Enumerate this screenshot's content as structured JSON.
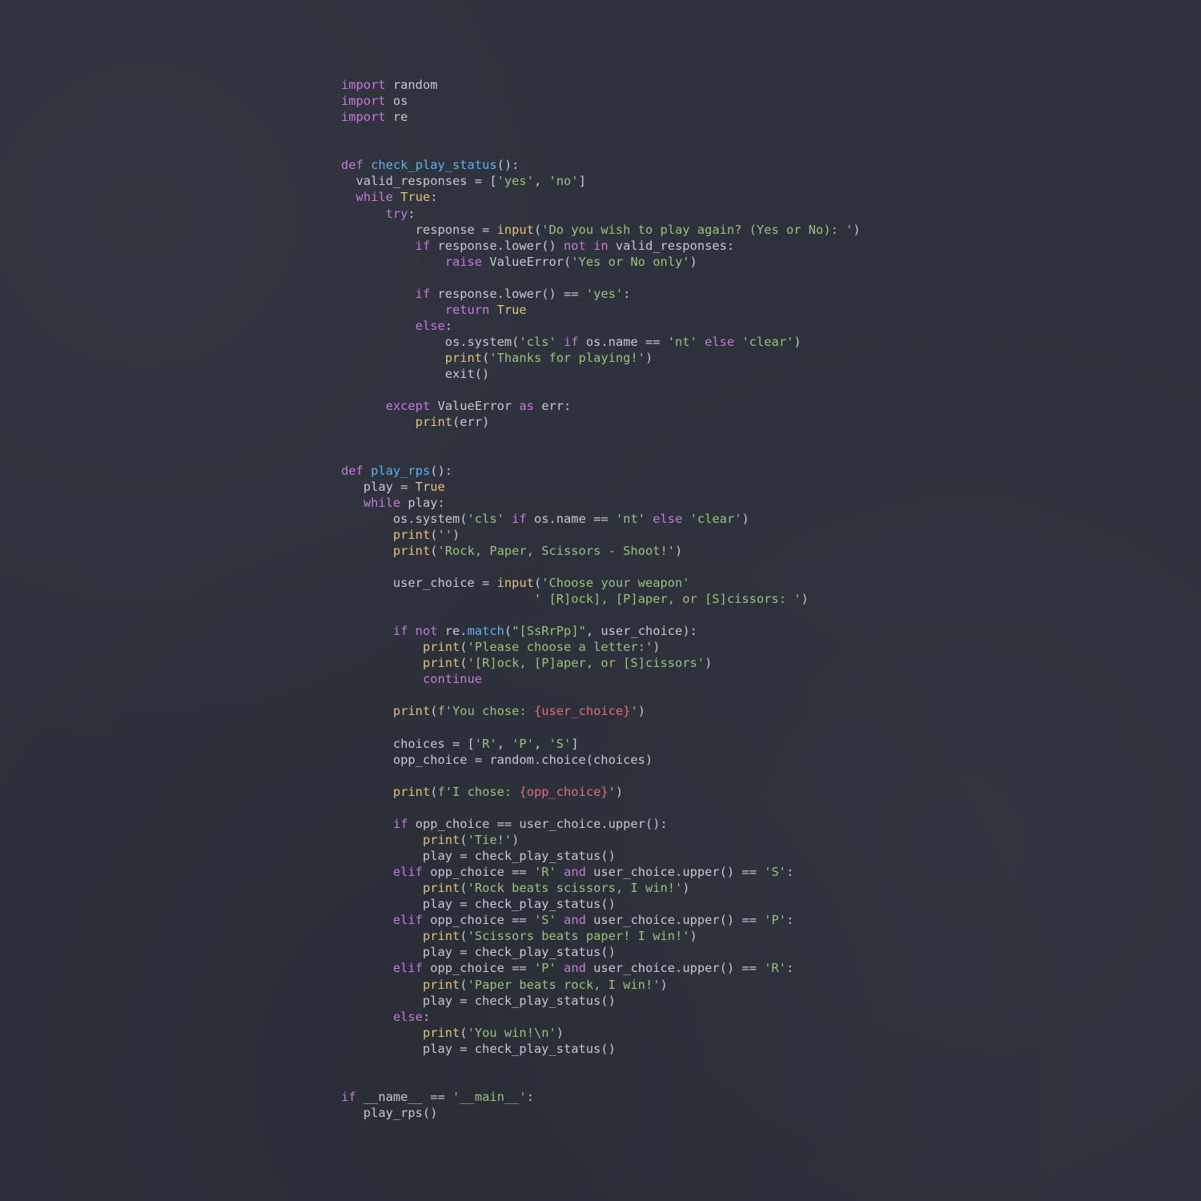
{
  "editor": {
    "language": "python",
    "colors": {
      "background": "#2d313b",
      "keyword": "#c678dd",
      "function": "#61afef",
      "builtin": "#e5c07b",
      "string": "#98c379",
      "constant": "#e5c07b",
      "text": "#c3c8d2",
      "interpolation": "#e06c75"
    },
    "lines": [
      [
        [
          "kw",
          "import"
        ],
        [
          "txt",
          " random"
        ]
      ],
      [
        [
          "kw",
          "import"
        ],
        [
          "txt",
          " os"
        ]
      ],
      [
        [
          "kw",
          "import"
        ],
        [
          "txt",
          " re"
        ]
      ],
      [],
      [],
      [
        [
          "kw",
          "def"
        ],
        [
          "txt",
          " "
        ],
        [
          "fn",
          "check_play_status"
        ],
        [
          "txt",
          "():"
        ]
      ],
      [
        [
          "txt",
          "  valid_responses = ["
        ],
        [
          "str",
          "'yes'"
        ],
        [
          "txt",
          ", "
        ],
        [
          "str",
          "'no'"
        ],
        [
          "txt",
          "]"
        ]
      ],
      [
        [
          "txt",
          "  "
        ],
        [
          "kw",
          "while"
        ],
        [
          "txt",
          " "
        ],
        [
          "cls",
          "True"
        ],
        [
          "txt",
          ":"
        ]
      ],
      [
        [
          "txt",
          "      "
        ],
        [
          "kw",
          "try"
        ],
        [
          "txt",
          ":"
        ]
      ],
      [
        [
          "txt",
          "          response = "
        ],
        [
          "bi",
          "input"
        ],
        [
          "txt",
          "("
        ],
        [
          "str",
          "'Do you wish to play again? (Yes or No): '"
        ],
        [
          "txt",
          ")"
        ]
      ],
      [
        [
          "txt",
          "          "
        ],
        [
          "kw",
          "if"
        ],
        [
          "txt",
          " response.lower() "
        ],
        [
          "kw",
          "not in"
        ],
        [
          "txt",
          " valid_responses:"
        ]
      ],
      [
        [
          "txt",
          "              "
        ],
        [
          "kw",
          "raise"
        ],
        [
          "txt",
          " ValueError("
        ],
        [
          "str",
          "'Yes or No only'"
        ],
        [
          "txt",
          ")"
        ]
      ],
      [],
      [
        [
          "txt",
          "          "
        ],
        [
          "kw",
          "if"
        ],
        [
          "txt",
          " response.lower() == "
        ],
        [
          "str",
          "'yes'"
        ],
        [
          "txt",
          ":"
        ]
      ],
      [
        [
          "txt",
          "              "
        ],
        [
          "kw",
          "return"
        ],
        [
          "txt",
          " "
        ],
        [
          "cls",
          "True"
        ]
      ],
      [
        [
          "txt",
          "          "
        ],
        [
          "kw",
          "else"
        ],
        [
          "txt",
          ":"
        ]
      ],
      [
        [
          "txt",
          "              os.system("
        ],
        [
          "str",
          "'cls'"
        ],
        [
          "txt",
          " "
        ],
        [
          "kw",
          "if"
        ],
        [
          "txt",
          " os.name == "
        ],
        [
          "str",
          "'nt'"
        ],
        [
          "txt",
          " "
        ],
        [
          "kw",
          "else"
        ],
        [
          "txt",
          " "
        ],
        [
          "str",
          "'clear'"
        ],
        [
          "txt",
          ")"
        ]
      ],
      [
        [
          "txt",
          "              "
        ],
        [
          "bi",
          "print"
        ],
        [
          "txt",
          "("
        ],
        [
          "str",
          "'Thanks for playing!'"
        ],
        [
          "txt",
          ")"
        ]
      ],
      [
        [
          "txt",
          "              exit()"
        ]
      ],
      [],
      [
        [
          "txt",
          "      "
        ],
        [
          "kw",
          "except"
        ],
        [
          "txt",
          " ValueError "
        ],
        [
          "kw",
          "as"
        ],
        [
          "txt",
          " err:"
        ]
      ],
      [
        [
          "txt",
          "          "
        ],
        [
          "bi",
          "print"
        ],
        [
          "txt",
          "(err)"
        ]
      ],
      [],
      [],
      [
        [
          "kw",
          "def"
        ],
        [
          "txt",
          " "
        ],
        [
          "fn",
          "play_rps"
        ],
        [
          "txt",
          "():"
        ]
      ],
      [
        [
          "txt",
          "   play = "
        ],
        [
          "cls",
          "True"
        ]
      ],
      [
        [
          "txt",
          "   "
        ],
        [
          "kw",
          "while"
        ],
        [
          "txt",
          " play:"
        ]
      ],
      [
        [
          "txt",
          "       os.system("
        ],
        [
          "str",
          "'cls'"
        ],
        [
          "txt",
          " "
        ],
        [
          "kw",
          "if"
        ],
        [
          "txt",
          " os.name == "
        ],
        [
          "str",
          "'nt'"
        ],
        [
          "txt",
          " "
        ],
        [
          "kw",
          "else"
        ],
        [
          "txt",
          " "
        ],
        [
          "str",
          "'clear'"
        ],
        [
          "txt",
          ")"
        ]
      ],
      [
        [
          "txt",
          "       "
        ],
        [
          "bi",
          "print"
        ],
        [
          "txt",
          "("
        ],
        [
          "str",
          "''"
        ],
        [
          "txt",
          ")"
        ]
      ],
      [
        [
          "txt",
          "       "
        ],
        [
          "bi",
          "print"
        ],
        [
          "txt",
          "("
        ],
        [
          "str",
          "'Rock, Paper, Scissors - Shoot!'"
        ],
        [
          "txt",
          ")"
        ]
      ],
      [],
      [
        [
          "txt",
          "       user_choice = "
        ],
        [
          "bi",
          "input"
        ],
        [
          "txt",
          "("
        ],
        [
          "str",
          "'Choose your weapon'"
        ]
      ],
      [
        [
          "txt",
          "                          "
        ],
        [
          "str",
          "' [R]ock], [P]aper, or [S]cissors: '"
        ],
        [
          "txt",
          ")"
        ]
      ],
      [],
      [
        [
          "txt",
          "       "
        ],
        [
          "kw",
          "if not"
        ],
        [
          "txt",
          " re."
        ],
        [
          "fn",
          "match"
        ],
        [
          "txt",
          "("
        ],
        [
          "str",
          "\"[SsRrPp]\""
        ],
        [
          "txt",
          ", user_choice):"
        ]
      ],
      [
        [
          "txt",
          "           "
        ],
        [
          "bi",
          "print"
        ],
        [
          "txt",
          "("
        ],
        [
          "str",
          "'Please choose a letter:'"
        ],
        [
          "txt",
          ")"
        ]
      ],
      [
        [
          "txt",
          "           "
        ],
        [
          "bi",
          "print"
        ],
        [
          "txt",
          "("
        ],
        [
          "str",
          "'[R]ock, [P]aper, or [S]cissors'"
        ],
        [
          "txt",
          ")"
        ]
      ],
      [
        [
          "txt",
          "           "
        ],
        [
          "kw",
          "continue"
        ]
      ],
      [],
      [
        [
          "txt",
          "       "
        ],
        [
          "bi",
          "print"
        ],
        [
          "txt",
          "("
        ],
        [
          "str",
          "f'You chose: "
        ],
        [
          "int",
          "{user_choice}"
        ],
        [
          "str",
          "'"
        ],
        [
          "txt",
          ")"
        ]
      ],
      [],
      [
        [
          "txt",
          "       choices = ["
        ],
        [
          "str",
          "'R'"
        ],
        [
          "txt",
          ", "
        ],
        [
          "str",
          "'P'"
        ],
        [
          "txt",
          ", "
        ],
        [
          "str",
          "'S'"
        ],
        [
          "txt",
          "]"
        ]
      ],
      [
        [
          "txt",
          "       opp_choice = random.choice(choices)"
        ]
      ],
      [],
      [
        [
          "txt",
          "       "
        ],
        [
          "bi",
          "print"
        ],
        [
          "txt",
          "("
        ],
        [
          "str",
          "f'I chose: "
        ],
        [
          "int",
          "{opp_choice}"
        ],
        [
          "str",
          "'"
        ],
        [
          "txt",
          ")"
        ]
      ],
      [],
      [
        [
          "txt",
          "       "
        ],
        [
          "kw",
          "if"
        ],
        [
          "txt",
          " opp_choice == user_choice.upper():"
        ]
      ],
      [
        [
          "txt",
          "           "
        ],
        [
          "bi",
          "print"
        ],
        [
          "txt",
          "("
        ],
        [
          "str",
          "'Tie!'"
        ],
        [
          "txt",
          ")"
        ]
      ],
      [
        [
          "txt",
          "           play = check_play_status()"
        ]
      ],
      [
        [
          "txt",
          "       "
        ],
        [
          "kw",
          "elif"
        ],
        [
          "txt",
          " opp_choice == "
        ],
        [
          "str",
          "'R'"
        ],
        [
          "txt",
          " "
        ],
        [
          "kw",
          "and"
        ],
        [
          "txt",
          " user_choice.upper() == "
        ],
        [
          "str",
          "'S'"
        ],
        [
          "txt",
          ":"
        ]
      ],
      [
        [
          "txt",
          "           "
        ],
        [
          "bi",
          "print"
        ],
        [
          "txt",
          "("
        ],
        [
          "str",
          "'Rock beats scissors, I win!'"
        ],
        [
          "txt",
          ")"
        ]
      ],
      [
        [
          "txt",
          "           play = check_play_status()"
        ]
      ],
      [
        [
          "txt",
          "       "
        ],
        [
          "kw",
          "elif"
        ],
        [
          "txt",
          " opp_choice == "
        ],
        [
          "str",
          "'S'"
        ],
        [
          "txt",
          " "
        ],
        [
          "kw",
          "and"
        ],
        [
          "txt",
          " user_choice.upper() == "
        ],
        [
          "str",
          "'P'"
        ],
        [
          "txt",
          ":"
        ]
      ],
      [
        [
          "txt",
          "           "
        ],
        [
          "bi",
          "print"
        ],
        [
          "txt",
          "("
        ],
        [
          "str",
          "'Scissors beats paper! I win!'"
        ],
        [
          "txt",
          ")"
        ]
      ],
      [
        [
          "txt",
          "           play = check_play_status()"
        ]
      ],
      [
        [
          "txt",
          "       "
        ],
        [
          "kw",
          "elif"
        ],
        [
          "txt",
          " opp_choice == "
        ],
        [
          "str",
          "'P'"
        ],
        [
          "txt",
          " "
        ],
        [
          "kw",
          "and"
        ],
        [
          "txt",
          " user_choice.upper() == "
        ],
        [
          "str",
          "'R'"
        ],
        [
          "txt",
          ":"
        ]
      ],
      [
        [
          "txt",
          "           "
        ],
        [
          "bi",
          "print"
        ],
        [
          "txt",
          "("
        ],
        [
          "str",
          "'Paper beats rock, I win!'"
        ],
        [
          "txt",
          ")"
        ]
      ],
      [
        [
          "txt",
          "           play = check_play_status()"
        ]
      ],
      [
        [
          "txt",
          "       "
        ],
        [
          "kw",
          "else"
        ],
        [
          "txt",
          ":"
        ]
      ],
      [
        [
          "txt",
          "           "
        ],
        [
          "bi",
          "print"
        ],
        [
          "txt",
          "("
        ],
        [
          "str",
          "'You win!\\n'"
        ],
        [
          "txt",
          ")"
        ]
      ],
      [
        [
          "txt",
          "           play = check_play_status()"
        ]
      ],
      [],
      [],
      [
        [
          "kw",
          "if"
        ],
        [
          "txt",
          " __name__ == "
        ],
        [
          "str",
          "'__main__'"
        ],
        [
          "txt",
          ":"
        ]
      ],
      [
        [
          "txt",
          "   play_rps()"
        ]
      ]
    ]
  }
}
